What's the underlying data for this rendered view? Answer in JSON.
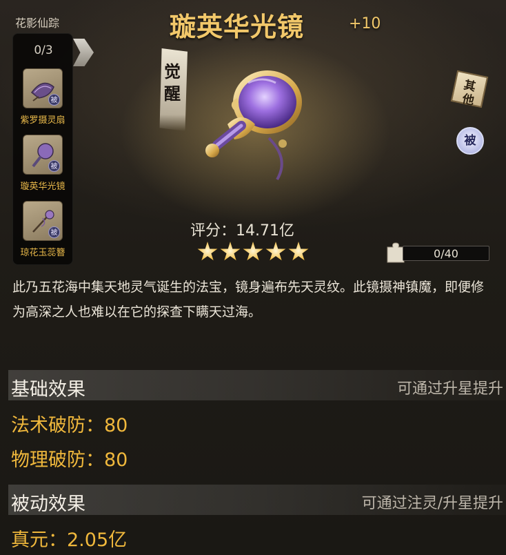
{
  "collection": {
    "title": "花影仙踪",
    "count": "0/3",
    "items": [
      {
        "label": "紫罗摄灵扇",
        "tag": "被"
      },
      {
        "label": "璇英华光镜",
        "tag": "被"
      },
      {
        "label": "琼花玉蕊簪",
        "tag": "被"
      }
    ]
  },
  "item": {
    "name": "璇英华光镜",
    "level": "+10",
    "awaken_chars": [
      "觉",
      "醒"
    ],
    "score": "评分：14.71亿",
    "stars": 5,
    "fragment_progress": "0/40",
    "fragment_fraction": 0,
    "description": "此乃五花海中集天地灵气诞生的法宝，镜身遍布先天灵纹。此镜摄神镇魔，即便修为高深之人也难以在它的探查下瞒天过海。"
  },
  "badges": {
    "other_chars": [
      "其",
      "他"
    ],
    "passive": "被"
  },
  "sections": {
    "basic": {
      "title": "基础效果",
      "hint": "可通过升星提升",
      "stats": [
        "法术破防：80",
        "物理破防：80"
      ]
    },
    "passive": {
      "title": "被动效果",
      "hint": "可通过注灵/升星提升",
      "stats": [
        "真元：2.05亿"
      ]
    }
  },
  "colors": {
    "title_gold": "#f2c86a",
    "stat_orange": "#f0b83c",
    "label_gold": "#e9b94a"
  }
}
